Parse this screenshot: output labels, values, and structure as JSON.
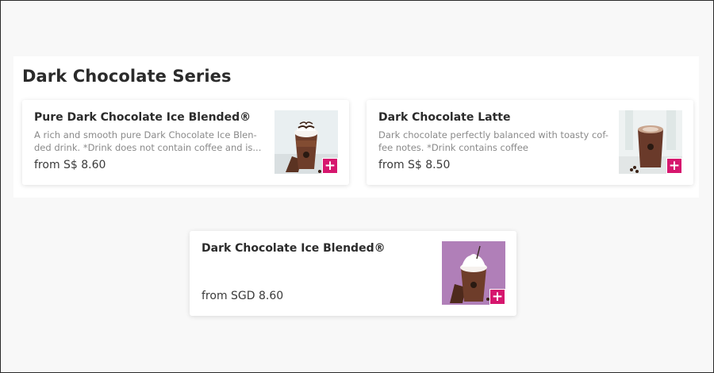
{
  "section": {
    "title": "Dark Chocolate Series"
  },
  "products": [
    {
      "name": "Pure Dark Chocolate Ice Blended®",
      "desc_line1": "A rich and smooth pure Dark Chocolate Ice Blen-",
      "desc_line2": "ded drink. *Drink does not contain coffee and is...",
      "price": "from S$ 8.60",
      "image_icon": "iced-chocolate-drink-icon",
      "add_icon": "plus-icon"
    },
    {
      "name": "Dark Chocolate Latte",
      "desc_line1": "Dark chocolate perfectly balanced with toasty cof-",
      "desc_line2": "fee notes. *Drink contains coffee",
      "price": "from S$ 8.50",
      "image_icon": "latte-glass-icon",
      "add_icon": "plus-icon"
    },
    {
      "name": "Dark Chocolate Ice Blended®",
      "price": "from SGD 8.60",
      "image_icon": "blended-chocolate-drink-icon",
      "add_icon": "plus-icon"
    }
  ],
  "colors": {
    "accent": "#d6176e",
    "thumb_purple": "#b07fb8",
    "page_bg": "#f8f8f8"
  },
  "add_symbol": "+"
}
